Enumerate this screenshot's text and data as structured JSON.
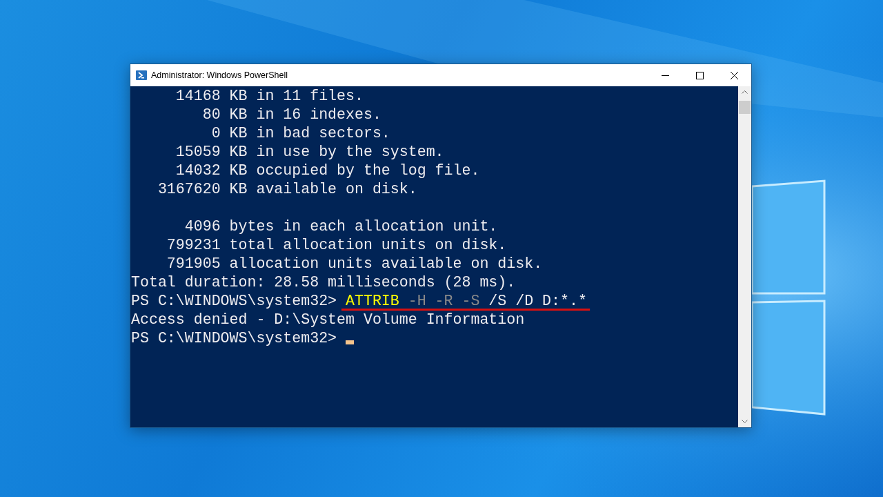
{
  "window": {
    "title": "Administrator: Windows PowerShell"
  },
  "console": {
    "lines": [
      {
        "segments": [
          {
            "text": "     14168 KB in 11 files.",
            "kind": "output"
          }
        ]
      },
      {
        "segments": [
          {
            "text": "        80 KB in 16 indexes.",
            "kind": "output"
          }
        ]
      },
      {
        "segments": [
          {
            "text": "         0 KB in bad sectors.",
            "kind": "output"
          }
        ]
      },
      {
        "segments": [
          {
            "text": "     15059 KB in use by the system.",
            "kind": "output"
          }
        ]
      },
      {
        "segments": [
          {
            "text": "     14032 KB occupied by the log file.",
            "kind": "output"
          }
        ]
      },
      {
        "segments": [
          {
            "text": "   3167620 KB available on disk.",
            "kind": "output"
          }
        ]
      },
      {
        "blank_line_before": true,
        "segments": [
          {
            "text": "      4096 bytes in each allocation unit.",
            "kind": "output"
          }
        ]
      },
      {
        "segments": [
          {
            "text": "    799231 total allocation units on disk.",
            "kind": "output"
          }
        ]
      },
      {
        "segments": [
          {
            "text": "    791905 allocation units available on disk.",
            "kind": "output"
          }
        ]
      },
      {
        "segments": [
          {
            "text": "Total duration: 28.58 milliseconds (28 ms).",
            "kind": "output"
          }
        ]
      },
      {
        "segments": [
          {
            "text": "PS C:\\WINDOWS\\system32> ",
            "kind": "prompt"
          },
          {
            "text": "ATTRIB ",
            "kind": "command"
          },
          {
            "text": "-H -R -S",
            "kind": "parameter"
          },
          {
            "text": " /S /D D:*.*",
            "kind": "output"
          }
        ],
        "underlined": true
      },
      {
        "segments": [
          {
            "text": "Access denied - D:\\System Volume Information",
            "kind": "output"
          }
        ]
      },
      {
        "segments": [
          {
            "text": "PS C:\\WINDOWS\\system32> ",
            "kind": "prompt"
          }
        ],
        "cursor": true
      }
    ]
  }
}
